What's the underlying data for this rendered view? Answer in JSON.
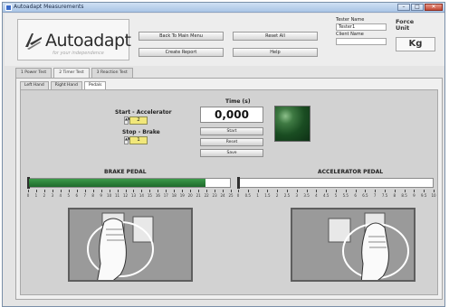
{
  "window": {
    "title": "Autoadapt Measurements"
  },
  "header": {
    "logo_text": "Autoadapt",
    "logo_tagline": "for your independence",
    "buttons": {
      "back": "Back To Main Menu",
      "reset_all": "Reset All",
      "create_report": "Create Report",
      "help": "Help"
    },
    "tester_name_label": "Tester Name",
    "tester_name_value": "Tester1",
    "client_name_label": "Client Name",
    "client_name_value": "",
    "force_label": "Force",
    "unit_label": "Unit",
    "unit_value": "Kg"
  },
  "tabs_outer": [
    {
      "label": "1 Power Test",
      "active": false
    },
    {
      "label": "2 Timer Test",
      "active": true
    },
    {
      "label": "3 Reaction Test",
      "active": false
    }
  ],
  "tabs_inner": [
    {
      "label": "Left Hand",
      "active": false
    },
    {
      "label": "Right Hand",
      "active": false
    },
    {
      "label": "Pedals",
      "active": true
    }
  ],
  "timer": {
    "start_label": "Start - Accelerator",
    "start_value": "2",
    "stop_label": "Stop - Brake",
    "stop_value": "1",
    "time_label": "Time (s)",
    "time_value": "0,000",
    "buttons": {
      "start": "Start",
      "reset": "Reset",
      "save": "Save"
    },
    "led_color": "#2f6b36"
  },
  "brake": {
    "label": "BRAKE PEDAL",
    "level": 0.88,
    "ticks": [
      "0",
      "1",
      "2",
      "3",
      "4",
      "5",
      "6",
      "7",
      "8",
      "9",
      "10",
      "11",
      "12",
      "13",
      "14",
      "15",
      "16",
      "17",
      "18",
      "19",
      "20",
      "21",
      "22",
      "23",
      "24",
      "25"
    ]
  },
  "accelerator": {
    "label": "ACCELERATOR PEDAL",
    "level": 0.0,
    "ticks": [
      "0",
      "0.5",
      "1",
      "1.5",
      "2",
      "2.5",
      "3",
      "3.5",
      "4",
      "4.5",
      "5",
      "5.5",
      "6",
      "6.5",
      "7",
      "7.5",
      "8",
      "8.5",
      "9",
      "9.5",
      "10"
    ]
  },
  "colors": {
    "accent": "#2b8a3a",
    "num_field": "#f1e77a"
  }
}
